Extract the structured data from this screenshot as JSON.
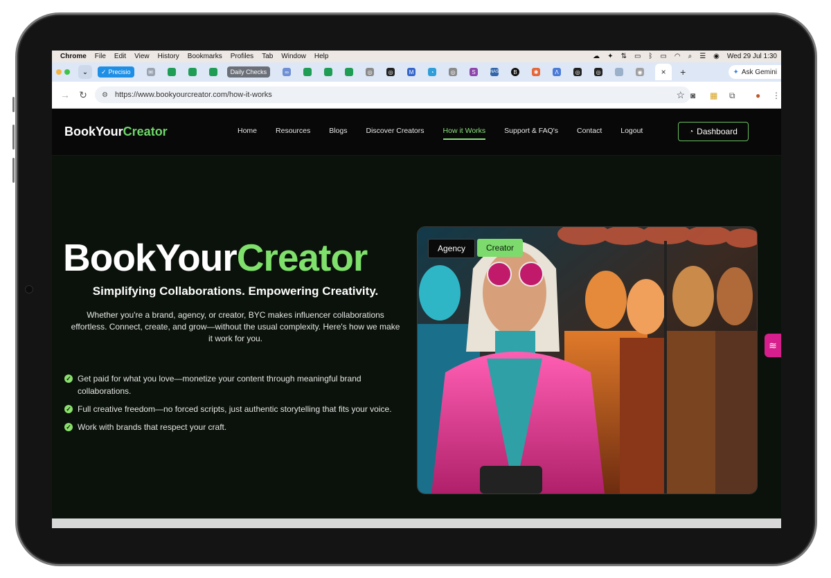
{
  "menubar": {
    "app": "Chrome",
    "items": [
      "File",
      "Edit",
      "View",
      "History",
      "Bookmarks",
      "Profiles",
      "Tab",
      "Window",
      "Help"
    ],
    "datetime": "Wed 29 Jul  1:30"
  },
  "tabs": {
    "pinned_label": "Precisio",
    "daily_checks": "Daily Checks",
    "active_close": "×",
    "new_tab": "+",
    "ask_gemini": "Ask Gemini"
  },
  "address": {
    "url": "https://www.bookyourcreator.com/how-it-works"
  },
  "site": {
    "logo_prefix": "BookYour",
    "logo_accent": "Creator",
    "nav": {
      "home": "Home",
      "resources": "Resources",
      "blogs": "Blogs",
      "discover": "Discover Creators",
      "how": "How it Works",
      "support": "Support & FAQ's",
      "contact": "Contact",
      "logout": "Logout"
    },
    "dashboard": "Dashboard",
    "hero": {
      "title_prefix": "BookYour",
      "title_accent": "Creator",
      "subtitle": "Simplifying Collaborations. Empowering Creativity.",
      "description": "Whether you're a brand, agency, or creator, BYC makes influencer collaborations effortless. Connect, create, and grow—without the usual complexity. Here's how we make it work for you.",
      "bullets": [
        "Get paid for what you love—monetize your content through meaningful brand collaborations.",
        "Full creative freedom—no forced scripts, just authentic storytelling that fits your voice.",
        "Work with brands that respect your craft."
      ]
    },
    "toggle": {
      "agency": "Agency",
      "creator": "Creator"
    }
  },
  "colors": {
    "accent_green": "#7fe06b",
    "site_bg": "#0b120b",
    "tab_bg": "#dde7f6"
  }
}
